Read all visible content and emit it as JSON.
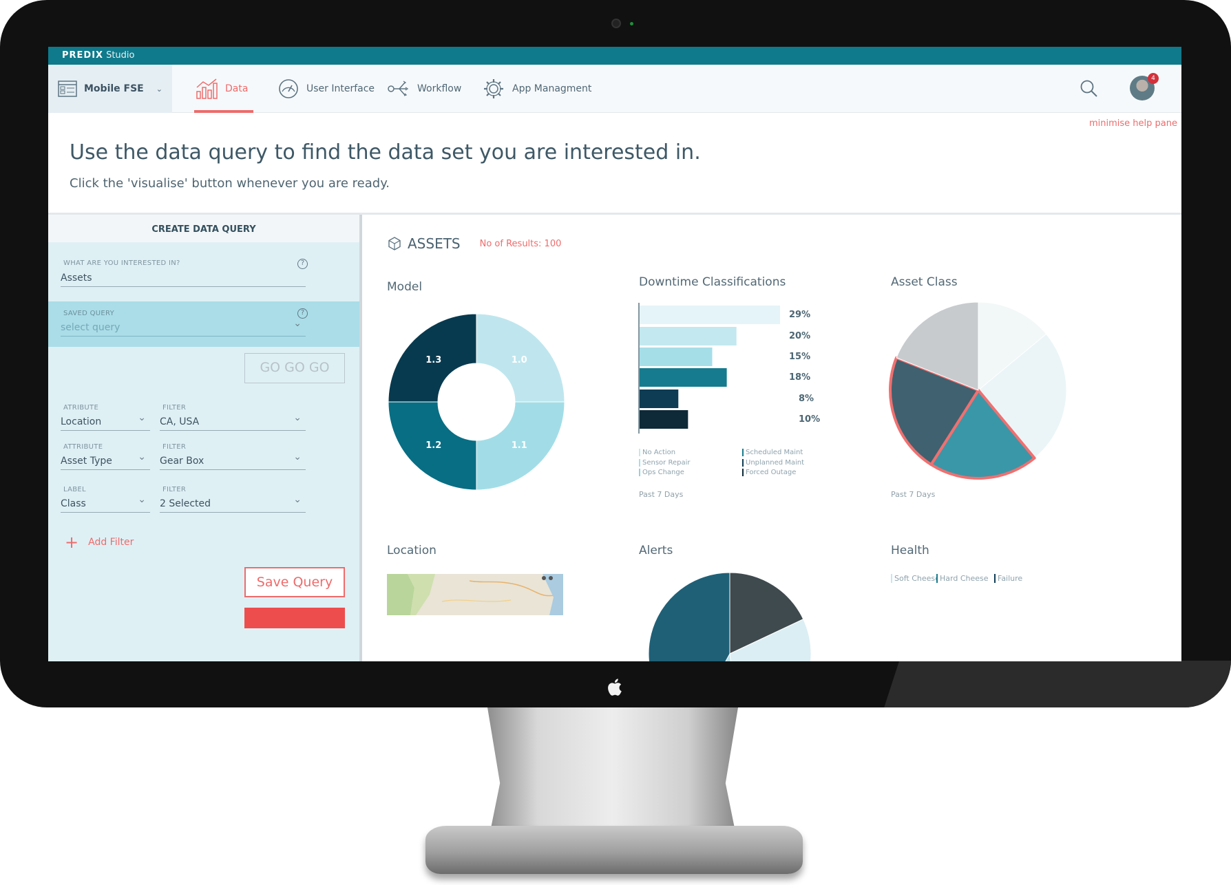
{
  "app": {
    "brand_strong": "PREDIX",
    "brand_light": "Studio",
    "project": "Mobile FSE",
    "nav": [
      {
        "label": "Data",
        "active": true
      },
      {
        "label": "User Interface"
      },
      {
        "label": "Workflow"
      },
      {
        "label": "App Managment"
      }
    ],
    "notifications": "4"
  },
  "help": {
    "minimise": "minimise help pane",
    "title": "Use the data query to find the data set you are interested in.",
    "subtitle": "Click the 'visualise' button whenever you are ready."
  },
  "query": {
    "header": "CREATE DATA QUERY",
    "interest_label": "WHAT ARE YOU INTERESTED IN?",
    "interest_value": "Assets",
    "saved_label": "SAVED QUERY",
    "saved_placeholder": "select query",
    "go_button": "GO GO GO",
    "rows": [
      {
        "left_label": "ATRIBUTE",
        "left_value": "Location",
        "right_label": "FILTER",
        "right_value": "CA, USA"
      },
      {
        "left_label": "ATTRIBUTE",
        "left_value": "Asset Type",
        "right_label": "FILTER",
        "right_value": "Gear Box"
      },
      {
        "left_label": "LABEL",
        "left_value": "Class",
        "right_label": "FILTER",
        "right_value": "2 Selected"
      }
    ],
    "add_filter": "Add Filter",
    "save_button": "Save Query"
  },
  "dashboard": {
    "section_title": "ASSETS",
    "results": "No of Results: 100",
    "model_title": "Model",
    "downtime_title": "Downtime Classifications",
    "asset_class_title": "Asset Class",
    "location_title": "Location",
    "alerts_title": "Alerts",
    "health_title": "Health",
    "period_note": "Past 7 Days",
    "downtime_legend": [
      "No Action",
      "Sensor Repair",
      "Ops Change",
      "Scheduled Maint",
      "Unplanned Maint",
      "Forced Outage"
    ],
    "health_legend": [
      "Soft Cheese",
      "Hard Cheese",
      "Failure"
    ]
  },
  "colors": {
    "brand": "#0f7a8b",
    "accent": "#ee6b6b",
    "navy": "#0b3e55",
    "teal": "#0e6e82"
  },
  "chart_data": [
    {
      "type": "pie",
      "title": "Model",
      "labels": [
        "1.0",
        "1.1",
        "1.2",
        "1.3"
      ],
      "values": [
        25,
        25,
        25,
        25
      ],
      "colors": [
        "#bfe6ee",
        "#a2dde7",
        "#086e84",
        "#083a4f"
      ]
    },
    {
      "type": "bar",
      "title": "Downtime Classifications",
      "categories": [
        "29%",
        "20%",
        "15%",
        "18%",
        "8%",
        "10%"
      ],
      "values": [
        29,
        20,
        15,
        18,
        8,
        10
      ],
      "colors": [
        "#e4f4f8",
        "#c3e8ef",
        "#a6dee8",
        "#167b8e",
        "#0d3c54",
        "#0e2a39"
      ]
    },
    {
      "type": "pie",
      "title": "Asset Class",
      "values": [
        14,
        25,
        20,
        22,
        19
      ],
      "colors": [
        "#f2f7f8",
        "#ebf5f7",
        "#3a97a7",
        "#40616f",
        "#c7cbce"
      ],
      "highlighted": [
        2,
        3
      ]
    },
    {
      "type": "pie",
      "title": "Alerts",
      "values": [
        18,
        30,
        10,
        42
      ],
      "colors": [
        "#3f4a4f",
        "#dbeef3",
        "#b6e1ea",
        "#1f6077"
      ]
    }
  ]
}
